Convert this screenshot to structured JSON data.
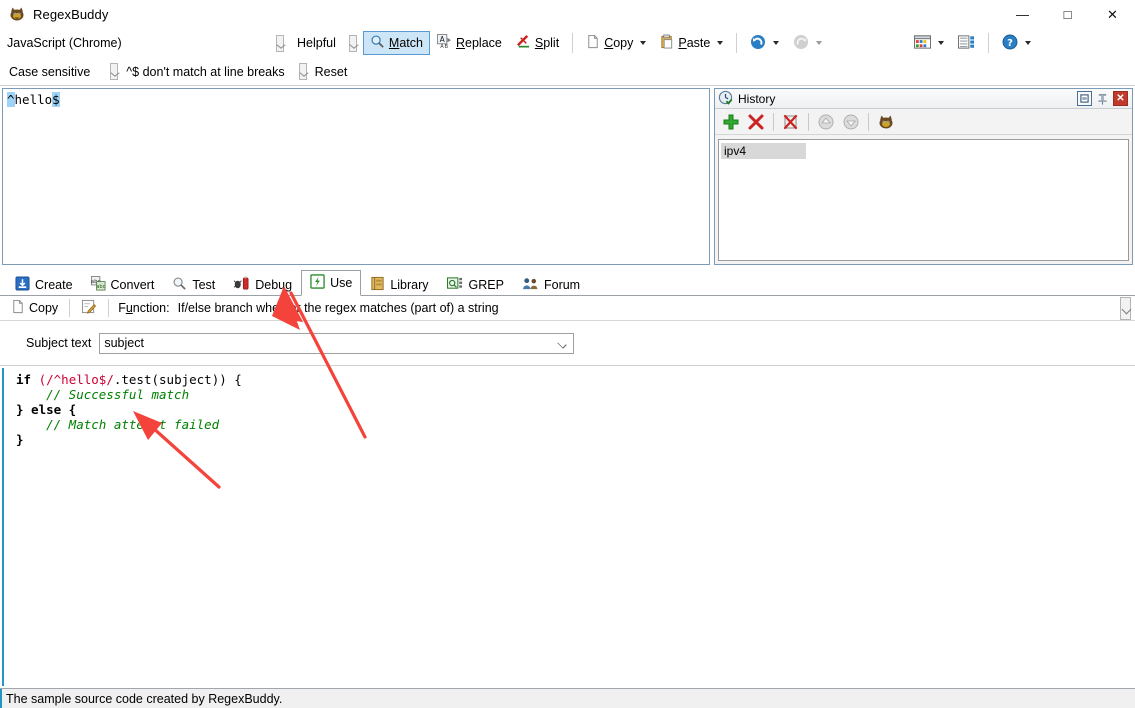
{
  "window": {
    "title": "RegexBuddy",
    "app_icon": "regexbuddy-logo-icon",
    "minimize": "—",
    "maximize": "□",
    "close": "✕"
  },
  "toolbar": {
    "flavor": "JavaScript (Chrome)",
    "helpful_label": "Helpful",
    "match_label": "Match",
    "replace_label": "Replace",
    "split_label": "Split",
    "copy_label": "Copy",
    "paste_label": "Paste",
    "undo_icon": "undo-icon",
    "redo_icon": "redo-icon",
    "grid_icon": "layout-grid-icon",
    "list_icon": "layout-list-icon",
    "help_icon": "help-question-icon"
  },
  "options": {
    "case_sensitive": "Case sensitive",
    "line_breaks": "^$ don't match at line breaks",
    "reset": "Reset"
  },
  "regex": {
    "prefix_anchor": "^",
    "body": "hello",
    "suffix_anchor": "$",
    "full": "^hello$"
  },
  "history": {
    "title": "History",
    "title_icon": "history-clock-icon",
    "restore_btn": "▣",
    "pin_btn": "pin-icon",
    "close_btn": "✕",
    "toolbar_icons": [
      "add-icon",
      "delete-icon",
      "delete-all-icon",
      "move-up-icon",
      "move-down-icon",
      "regexbuddy-icon"
    ],
    "items": [
      "ipv4"
    ]
  },
  "tabs": [
    {
      "label": "Create",
      "icon": "create-icon",
      "active": false
    },
    {
      "label": "Convert",
      "icon": "convert-icon",
      "active": false
    },
    {
      "label": "Test",
      "icon": "test-magnifier-icon",
      "active": false
    },
    {
      "label": "Debug",
      "icon": "debug-bug-icon",
      "active": false
    },
    {
      "label": "Use",
      "icon": "use-icon",
      "active": true
    },
    {
      "label": "Library",
      "icon": "library-icon",
      "active": false
    },
    {
      "label": "GREP",
      "icon": "grep-icon",
      "active": false
    },
    {
      "label": "Forum",
      "icon": "forum-people-icon",
      "active": false
    }
  ],
  "function_bar": {
    "copy_label": "Copy",
    "edit_icon": "edit-pencil-icon",
    "function_prefix": "F",
    "function_underlined": "u",
    "function_suffix": "nction:",
    "function_value": "If/else branch whether the regex matches (part of) a string"
  },
  "subject": {
    "label": "Subject text",
    "value": "subject",
    "placeholder": "subject"
  },
  "code": {
    "line1_kw": "if",
    "line1_regex": " (/^hello$/",
    "line1_rest": ".test(subject)) {",
    "line2_comment": "    // Successful match",
    "line3": "} else {",
    "line4_comment": "    // Match attempt failed",
    "line5": "}"
  },
  "status": {
    "text": "The sample source code created by RegexBuddy."
  },
  "annotations": {
    "arrow_color": "#f4433a",
    "arrow1_target": "use-tab",
    "arrow2_target": "code-comment-failed"
  }
}
